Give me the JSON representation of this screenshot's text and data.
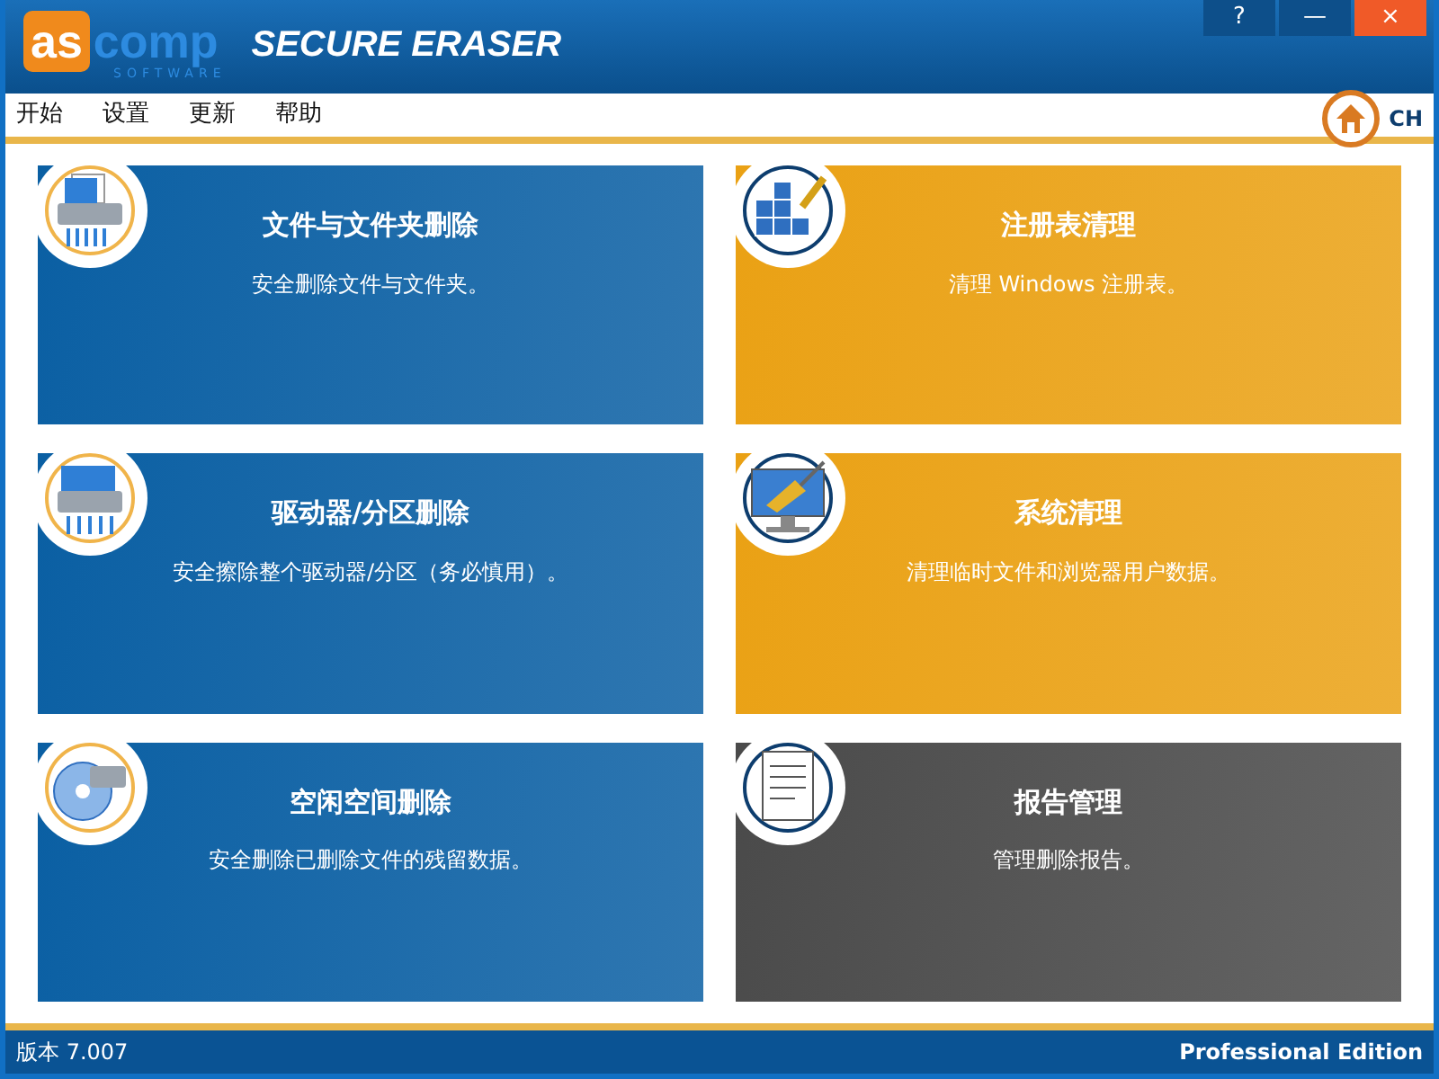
{
  "window": {
    "logo": "as",
    "logo_rest": "comp",
    "logo_sub": "SOFTWARE",
    "title": "SECURE ERASER",
    "buttons": [
      "?",
      "—",
      "×"
    ]
  },
  "menu": {
    "items": [
      "开始",
      "设置",
      "更新",
      "帮助"
    ],
    "language": "CH"
  },
  "tiles": [
    {
      "title": "文件与文件夹删除",
      "description": "安全删除文件与文件夹。",
      "color": "#0a5fa3",
      "kind": "shredder"
    },
    {
      "title": "注册表清理",
      "description": "清理 Windows 注册表。",
      "color": "#eaa114",
      "kind": "registry"
    },
    {
      "title": "驱动器/分区删除",
      "description": "安全擦除整个驱动器/分区（务必慎用）。",
      "color": "#0a5fa3",
      "kind": "drive"
    },
    {
      "title": "系统清理",
      "description": "清理临时文件和浏览器用户数据。",
      "color": "#eaa114",
      "kind": "monitor"
    },
    {
      "title": "空闲空间删除",
      "description": "安全删除已删除文件的残留数据。",
      "color": "#0a5fa3",
      "kind": "disc"
    },
    {
      "title": "报告管理",
      "description": "管理删除报告。",
      "color": "#4a4a4a",
      "kind": "report"
    }
  ],
  "status_bar": {
    "version": "版本 7.007",
    "edition": "Professional Edition"
  }
}
